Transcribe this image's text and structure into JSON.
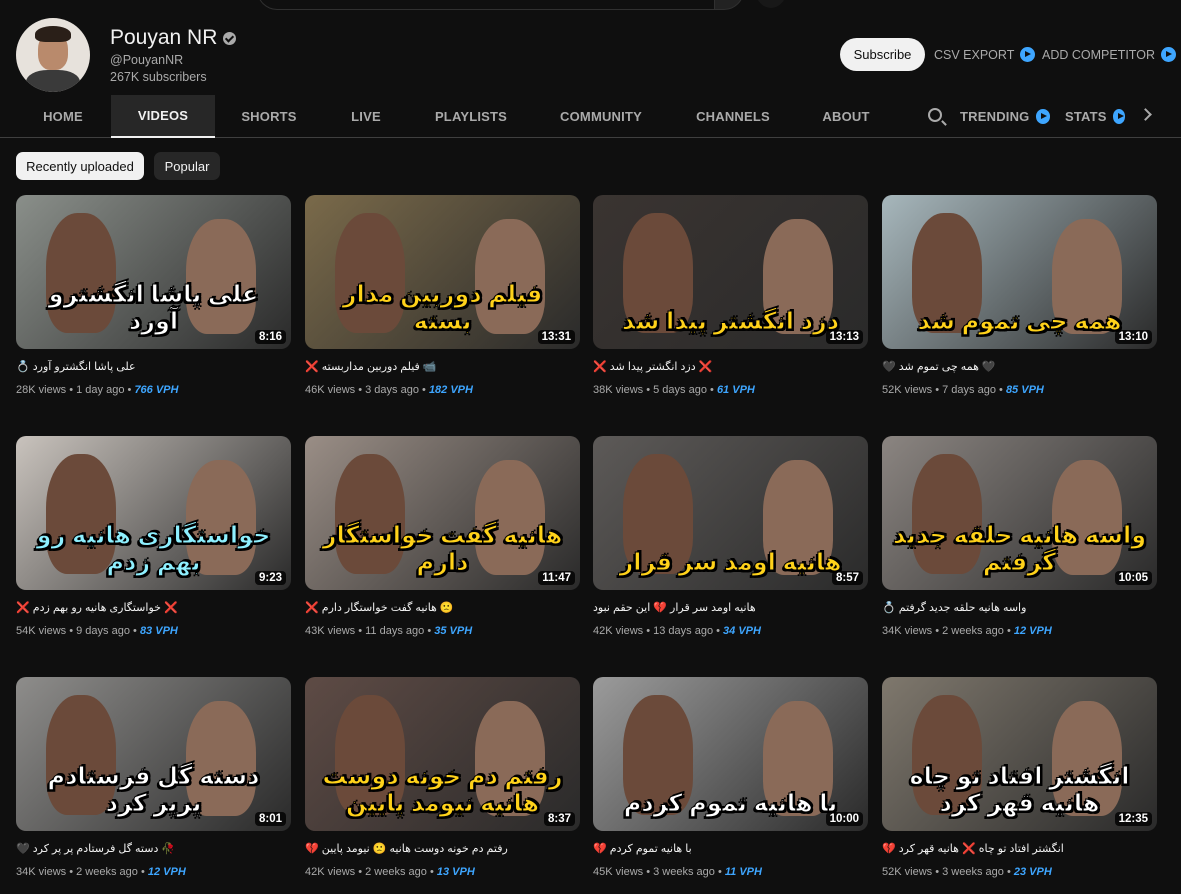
{
  "channel": {
    "name": "Pouyan NR",
    "handle": "@PouyanNR",
    "subscribers": "267K subscribers"
  },
  "actions": {
    "subscribe": "Subscribe",
    "csv_export": "CSV EXPORT",
    "add_competitor": "ADD COMPETITOR"
  },
  "tabs": [
    "HOME",
    "VIDEOS",
    "SHORTS",
    "LIVE",
    "PLAYLISTS",
    "COMMUNITY",
    "CHANNELS",
    "ABOUT"
  ],
  "extra_tabs": [
    "TRENDING",
    "STATS"
  ],
  "filters": [
    "Recently uploaded",
    "Popular"
  ],
  "videos": [
    {
      "title": "💍 علی پاشا انگشترو آورد",
      "views": "28K views",
      "age": "1 day ago",
      "vph": "766 VPH",
      "duration": "8:16",
      "headline": "علی پاشا انگشترو آورد",
      "bg": "#8a8f8a",
      "text_color": "#ffffff"
    },
    {
      "title": "❌ فیلم دوربین مداربسته 📹",
      "views": "46K views",
      "age": "3 days ago",
      "vph": "182 VPH",
      "duration": "13:31",
      "headline": "فیلم دوربین مدار بسته",
      "bg": "#7a6a4a",
      "text_color": "#ffd21a"
    },
    {
      "title": "❌ دزد انگشتر پیدا شد ❌",
      "views": "38K views",
      "age": "5 days ago",
      "vph": "61 VPH",
      "duration": "13:13",
      "headline": "دزد انگشتر پیدا شد",
      "bg": "#3a3431",
      "text_color": "#ffd21a"
    },
    {
      "title": "🖤 همه چی تموم شد 🖤",
      "views": "52K views",
      "age": "7 days ago",
      "vph": "85 VPH",
      "duration": "13:10",
      "headline": "همه چی تموم شد",
      "bg": "#a7b7bc",
      "text_color": "#ffd21a"
    },
    {
      "title": "❌ خواستگاری هانیه رو بهم زدم ❌",
      "views": "54K views",
      "age": "9 days ago",
      "vph": "83 VPH",
      "duration": "9:23",
      "headline": "خواستگاری هانیه رو بهم زدم",
      "bg": "#c9c3bd",
      "text_color": "#8ef0ff"
    },
    {
      "title": "❌ هانیه گفت خواستگار دارم 🙁",
      "views": "43K views",
      "age": "11 days ago",
      "vph": "35 VPH",
      "duration": "11:47",
      "headline": "هانیه گفت خواستگار دارم",
      "bg": "#9a8e86",
      "text_color": "#ffd21a"
    },
    {
      "title": "هانیه اومد سر قرار 💔 این حقم نبود",
      "views": "42K views",
      "age": "13 days ago",
      "vph": "34 VPH",
      "duration": "8:57",
      "headline": "هانیه اومد سر قرار",
      "bg": "#5d5a58",
      "text_color": "#ffd21a"
    },
    {
      "title": "💍 واسه هانیه حلقه جدید گرفتم",
      "views": "34K views",
      "age": "2 weeks ago",
      "vph": "12 VPH",
      "duration": "10:05",
      "headline": "واسه هانیه حلقه جدید گرفتم",
      "bg": "#8b8581",
      "text_color": "#ffd21a"
    },
    {
      "title": "🖤 دسته گل فرستادم پر پر کرد 🥀",
      "views": "34K views",
      "age": "2 weeks ago",
      "vph": "12 VPH",
      "duration": "8:01",
      "headline": "دسته گل فرستادم پرپر کرد",
      "bg": "#8e8d8b",
      "text_color": "#ffffff"
    },
    {
      "title": "💔 رفتم دم خونه دوست هانیه 🙁 نیومد پایین",
      "views": "42K views",
      "age": "2 weeks ago",
      "vph": "13 VPH",
      "duration": "8:37",
      "headline": "رفتم دم خونه دوست هانیه نیومد پایین",
      "bg": "#5e4b45",
      "text_color": "#ffd21a"
    },
    {
      "title": "💔 با هانیه تموم کردم",
      "views": "45K views",
      "age": "3 weeks ago",
      "vph": "11 VPH",
      "duration": "10:00",
      "headline": "با هانیه تموم کردم",
      "bg": "#9b9b9b",
      "text_color": "#ffffff"
    },
    {
      "title": "💔 انگشتر افتاد تو چاه ❌ هانیه قهر کرد",
      "views": "52K views",
      "age": "3 weeks ago",
      "vph": "23 VPH",
      "duration": "12:35",
      "headline": "انگشتر افتاد تو چاه هانیه قهر کرد",
      "bg": "#7f786d",
      "text_color": "#ffffff"
    }
  ]
}
